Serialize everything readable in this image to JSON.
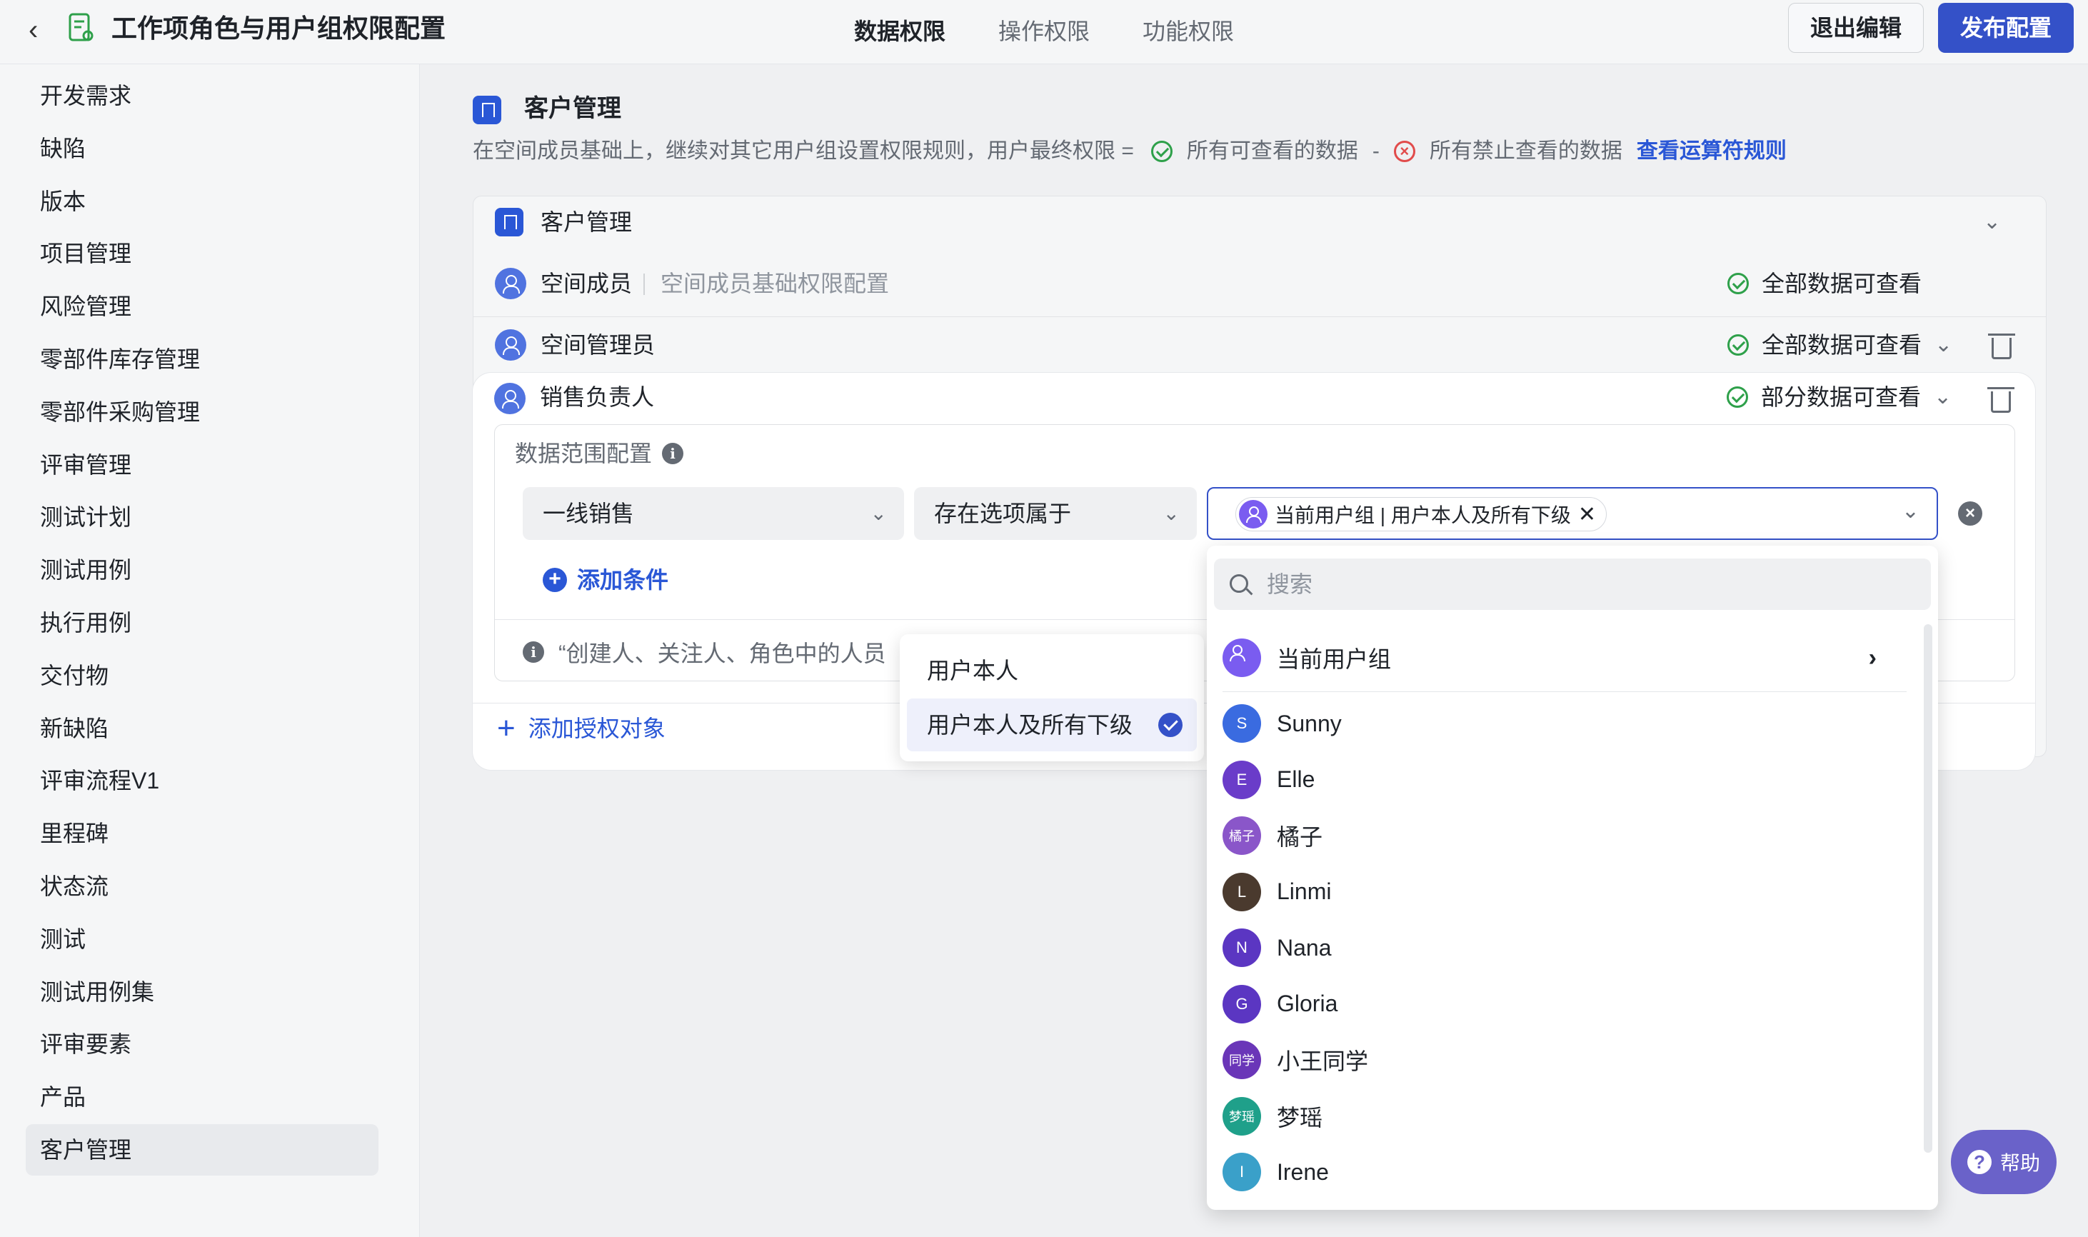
{
  "header": {
    "title": "工作项角色与用户组权限配置",
    "tabs": [
      "数据权限",
      "操作权限",
      "功能权限"
    ],
    "exit_label": "退出编辑",
    "publish_label": "发布配置"
  },
  "sidebar": {
    "items": [
      "开发需求",
      "缺陷",
      "版本",
      "项目管理",
      "风险管理",
      "零部件库存管理",
      "零部件采购管理",
      "评审管理",
      "测试计划",
      "测试用例",
      "执行用例",
      "交付物",
      "新缺陷",
      "评审流程V1",
      "里程碑",
      "状态流",
      "测试",
      "测试用例集",
      "评审要素",
      "产品",
      "客户管理"
    ],
    "active": "客户管理"
  },
  "section": {
    "title": "客户管理",
    "desc_prefix": "在空间成员基础上，继续对其它用户组设置权限规则，用户最终权限 =",
    "desc_allow": "所有可查看的数据",
    "desc_minus": "-",
    "desc_deny": "所有禁止查看的数据",
    "rule_link": "查看运算符规则"
  },
  "card": {
    "title": "客户管理",
    "rows": [
      {
        "name": "空间成员",
        "sub": "空间成员基础权限配置",
        "status": "全部数据可查看"
      },
      {
        "name": "空间管理员",
        "status": "全部数据可查看"
      },
      {
        "name": "销售负责人",
        "status": "部分数据可查看"
      }
    ]
  },
  "scope": {
    "label": "数据范围配置",
    "field": "一线销售",
    "operator": "存在选项属于",
    "tag": "当前用户组 | 用户本人及所有下级",
    "add_condition": "添加条件",
    "note": "“创建人、关注人、角色中的人员"
  },
  "add_object": "添加授权对象",
  "popup": {
    "options": [
      "用户本人",
      "用户本人及所有下级"
    ],
    "selected": "用户本人及所有下级"
  },
  "dropdown": {
    "search_placeholder": "搜索",
    "group": "当前用户组",
    "users": [
      {
        "name": "Sunny",
        "initial": "S",
        "color": "#3a6be0"
      },
      {
        "name": "Elle",
        "initial": "E",
        "color": "#6a3cc9"
      },
      {
        "name": "橘子",
        "initial": "橘子",
        "color": "#8a56c9"
      },
      {
        "name": "Linmi",
        "initial": "L",
        "color": "#4a3a2e"
      },
      {
        "name": "Nana",
        "initial": "N",
        "color": "#5b36c2"
      },
      {
        "name": "Gloria",
        "initial": "G",
        "color": "#5b36c2"
      },
      {
        "name": "小王同学",
        "initial": "同学",
        "color": "#6a36b8"
      },
      {
        "name": "梦瑶",
        "initial": "梦瑶",
        "color": "#1fa08a"
      },
      {
        "name": "Irene",
        "initial": "I",
        "color": "#3aa0c9"
      }
    ]
  },
  "help_label": "帮助"
}
